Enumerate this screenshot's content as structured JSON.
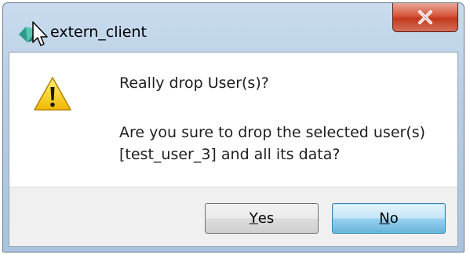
{
  "window": {
    "title": "extern_client",
    "close_label": "X"
  },
  "dialog": {
    "heading": "Really drop User(s)?",
    "message": "Are you sure to drop the selected user(s)\n[test_user_3] and all its data?",
    "icon": "warning-icon"
  },
  "buttons": {
    "yes_mnemonic": "Y",
    "yes_rest": "es",
    "no_mnemonic": "N",
    "no_rest": "o"
  },
  "colors": {
    "close_button": "#c13a1e",
    "default_button": "#98d1ef",
    "warning_yellow": "#f5c400"
  }
}
